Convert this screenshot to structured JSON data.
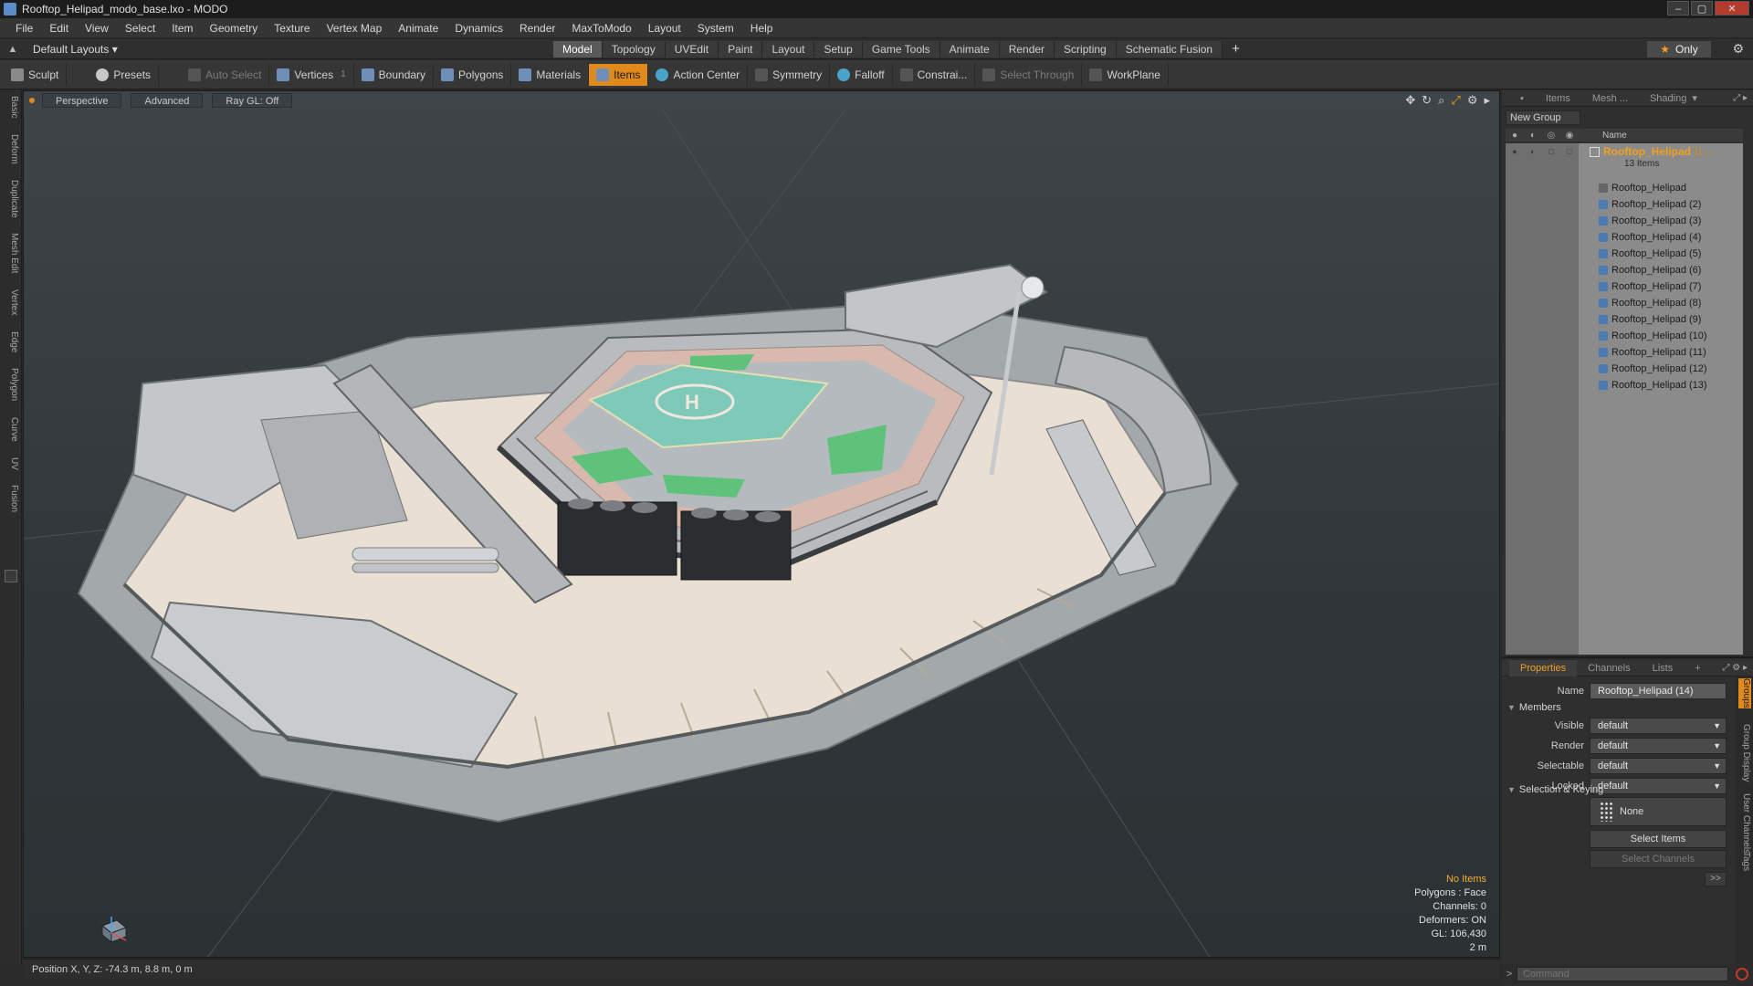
{
  "window": {
    "title": "Rooftop_Helipad_modo_base.lxo - MODO",
    "minimize": "–",
    "maximize": "▢",
    "close": "✕"
  },
  "menu": [
    "File",
    "Edit",
    "View",
    "Select",
    "Item",
    "Geometry",
    "Texture",
    "Vertex Map",
    "Animate",
    "Dynamics",
    "Render",
    "MaxToModo",
    "Layout",
    "System",
    "Help"
  ],
  "layoutbar": {
    "layouts_label": "Default Layouts ▾",
    "tabs": [
      "Model",
      "Topology",
      "UVEdit",
      "Paint",
      "Layout",
      "Setup",
      "Game Tools",
      "Animate",
      "Render",
      "Scripting",
      "Schematic Fusion"
    ],
    "active_tab": "Model",
    "add": "+",
    "only_label": "Only"
  },
  "toolbar": {
    "sculpt": "Sculpt",
    "presets": "Presets",
    "auto_select": "Auto Select",
    "vertices": "Vertices",
    "vertices_count": "1",
    "boundary": "Boundary",
    "polygons": "Polygons",
    "materials": "Materials",
    "items": "Items",
    "action_center": "Action Center",
    "symmetry": "Symmetry",
    "falloff": "Falloff",
    "constraints": "Constrai...",
    "select_through": "Select Through",
    "workplane": "WorkPlane"
  },
  "leftstrip": [
    "Basic",
    "Deform",
    "Duplicate",
    "Mesh Edit",
    "Vertex",
    "Edge",
    "Polygon",
    "Curve",
    "UV",
    "Fusion"
  ],
  "viewport": {
    "view_mode": "Perspective",
    "shading": "Advanced",
    "raygl": "Ray GL: Off",
    "info": {
      "selection": "No Items",
      "polygons": "Polygons : Face",
      "channels": "Channels: 0",
      "deformers": "Deformers: ON",
      "gl": "GL: 106,430",
      "scale": "2 m"
    }
  },
  "status": {
    "position": "Position X, Y, Z:  -74.3 m, 8.8 m, 0 m"
  },
  "items_panel": {
    "tabs": [
      "Items",
      "Mesh ...",
      "Shading"
    ],
    "new_group": "New Group",
    "name_header": "Name",
    "group": {
      "name": "Rooftop_Helipad",
      "suffix": "(1 ...",
      "count": "13 Items"
    },
    "children": [
      "Rooftop_Helipad",
      "Rooftop_Helipad (2)",
      "Rooftop_Helipad (3)",
      "Rooftop_Helipad (4)",
      "Rooftop_Helipad (5)",
      "Rooftop_Helipad (6)",
      "Rooftop_Helipad (7)",
      "Rooftop_Helipad (8)",
      "Rooftop_Helipad (9)",
      "Rooftop_Helipad (10)",
      "Rooftop_Helipad (11)",
      "Rooftop_Helipad (12)",
      "Rooftop_Helipad (13)"
    ]
  },
  "properties": {
    "tabs": [
      "Properties",
      "Channels",
      "Lists",
      "+"
    ],
    "name_label": "Name",
    "name_value": "Rooftop_Helipad (14)",
    "members_header": "Members",
    "visible_label": "Visible",
    "visible_value": "default",
    "render_label": "Render",
    "render_value": "default",
    "selectable_label": "Selectable",
    "selectable_value": "default",
    "locked_label": "Locked",
    "locked_value": "default",
    "sel_keying_header": "Selection & Keying",
    "none_label": "None",
    "select_items": "Select Items",
    "select_channels": "Select Channels",
    "expand": ">>",
    "vtabs": [
      "Groups",
      "Group Display",
      "User Channels",
      "Tags"
    ]
  },
  "command": {
    "placeholder": "Command"
  },
  "colors": {
    "accent": "#e08a1e",
    "helipad": "#7fc9b8",
    "grass": "#5fc27a"
  }
}
